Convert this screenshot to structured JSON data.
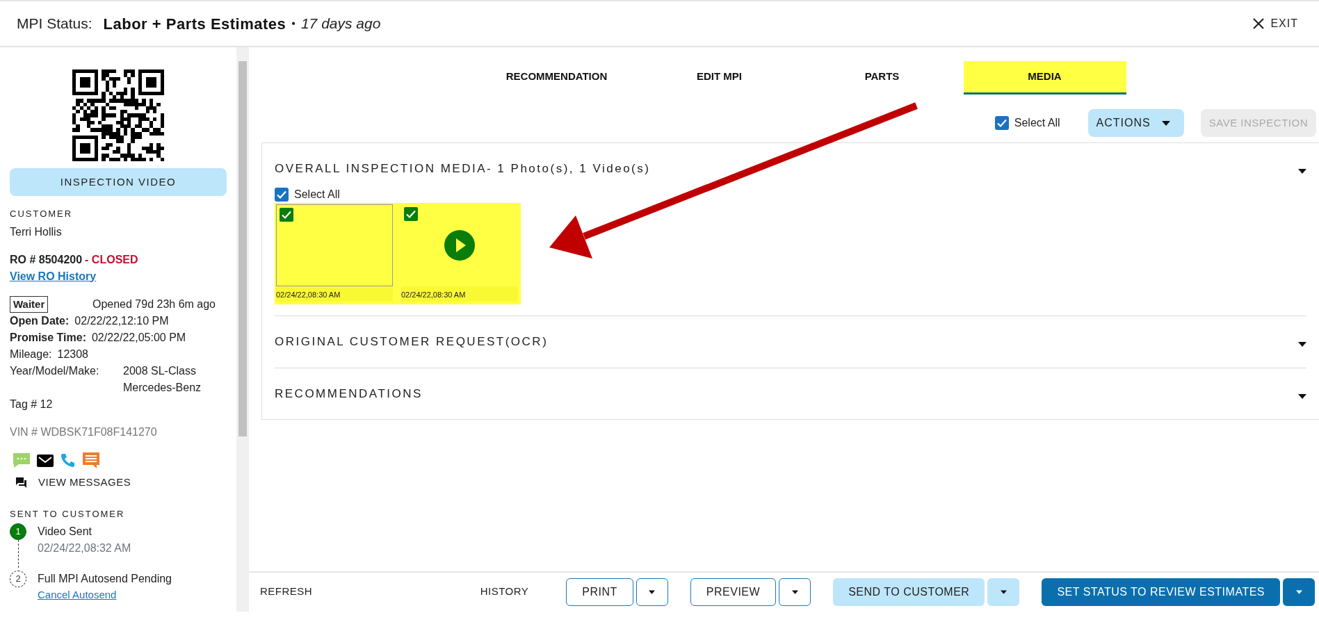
{
  "header": {
    "label": "MPI Status:",
    "status": "Labor + Parts Estimates",
    "separator": "•",
    "age": "17 days ago",
    "exit": "EXIT"
  },
  "sidebar": {
    "inspection_video_button": "INSPECTION VIDEO",
    "customer_label": "CUSTOMER",
    "customer_name": "Terri Hollis",
    "ro_number": "RO # 8504200",
    "ro_status": "- CLOSED",
    "ro_history_link": "View RO History",
    "tag": "Waiter",
    "opened": "Opened 79d 23h 6m ago",
    "details": [
      {
        "label": "Open Date:",
        "values": [
          "02/22/22,12:10 PM"
        ],
        "emphasized": true
      },
      {
        "label": "Promise Time:",
        "values": [
          "02/22/22,05:00 PM"
        ],
        "emphasized": true
      },
      {
        "label": "Mileage:",
        "values": [
          "12308"
        ],
        "emphasized": false
      },
      {
        "label": "Year/Model/Make:",
        "values": [
          "2008 SL-Class",
          "Mercedes-Benz"
        ],
        "emphasized": false
      }
    ],
    "tag_number": "Tag # 12",
    "vin": "VIN # WDBSK71F08F141270",
    "view_messages": "VIEW MESSAGES",
    "sent_title": "SENT TO CUSTOMER",
    "timeline": [
      {
        "step": "1",
        "title": "Video Sent",
        "subtitle": "02/24/22,08:32 AM",
        "done": true
      },
      {
        "step": "2",
        "title": "Full MPI Autosend Pending",
        "link": "Cancel Autosend",
        "done": false
      }
    ]
  },
  "tabs": [
    {
      "label": "RECOMMENDATION",
      "selected": false,
      "highlighted": false
    },
    {
      "label": "EDIT MPI",
      "selected": false,
      "highlighted": false
    },
    {
      "label": "PARTS",
      "selected": false,
      "highlighted": false
    },
    {
      "label": "MEDIA",
      "selected": true,
      "highlighted": true
    }
  ],
  "toolbar": {
    "select_all": {
      "label": "Select All",
      "checked": true
    },
    "actions": "ACTIONS",
    "save": {
      "label": "SAVE INSPECTION",
      "disabled": true
    }
  },
  "sections": [
    {
      "title": "OVERALL INSPECTION MEDIA- 1 Photo(s), 1 Video(s)",
      "select_all": {
        "label": "Select All",
        "checked": true
      },
      "highlighted": true,
      "media": [
        {
          "kind": "photo",
          "checked": true,
          "timestamp": "02/24/22,08:30 AM"
        },
        {
          "kind": "video",
          "checked": true,
          "timestamp": "02/24/22,08:30 AM"
        }
      ]
    },
    {
      "title": "ORIGINAL CUSTOMER REQUEST(OCR)"
    },
    {
      "title": "RECOMMENDATIONS"
    }
  ],
  "footer": {
    "refresh": "REFRESH",
    "history": "HISTORY",
    "buttons": [
      {
        "label": "PRINT",
        "kind": "outline"
      },
      {
        "label": "PREVIEW",
        "kind": "outline"
      },
      {
        "label": "SEND TO CUSTOMER",
        "kind": "light"
      },
      {
        "label": "SET STATUS TO REVIEW ESTIMATES",
        "kind": "primary"
      }
    ]
  }
}
